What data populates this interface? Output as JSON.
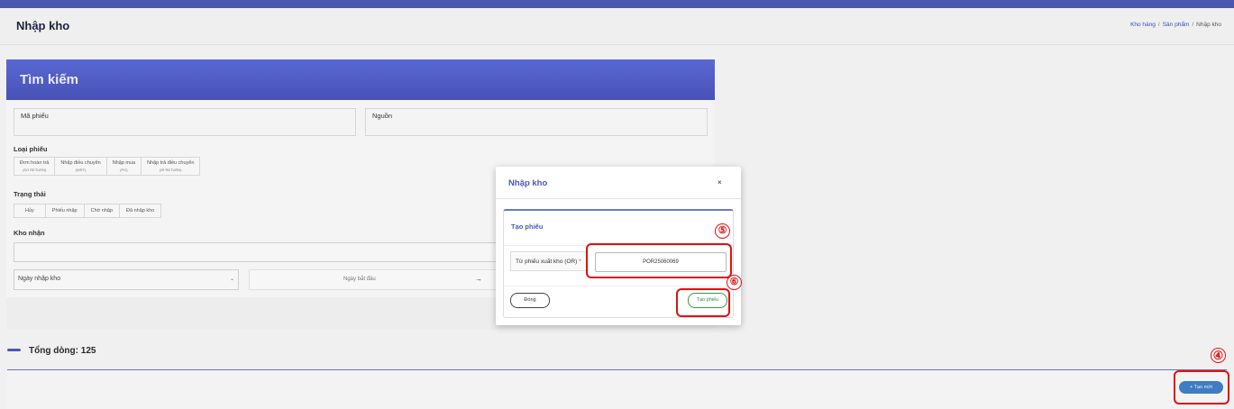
{
  "header": {
    "title": "Nhập kho",
    "breadcrumb": [
      "Kho hàng",
      "Sản phẩm",
      "Nhập kho"
    ]
  },
  "search": {
    "title": "Tìm kiếm",
    "code_label": "Mã phiếu",
    "source_label": "Nguồn",
    "type_label": "Loại phiếu",
    "types": [
      {
        "label": "Đơn hoàn trả",
        "sub": "(SO RETURN)"
      },
      {
        "label": "Nhập điều chuyển",
        "sub": "(WRT)"
      },
      {
        "label": "Nhập mua",
        "sub": "(PO)"
      },
      {
        "label": "Nhập trả điều chuyển",
        "sub": "(IR RETURN)"
      }
    ],
    "status_label": "Trạng thái",
    "statuses": [
      "Hủy",
      "Phiếu nhập",
      "Chờ nhập",
      "Đã nhập kho"
    ],
    "warehouse_label": "Kho nhận",
    "date_select": "Ngày nhập kho",
    "date_start_placeholder": "Ngày bắt đầu",
    "date_arrow": "→"
  },
  "list": {
    "total": "Tổng dòng: 125",
    "new_button": "+ Tạo mới"
  },
  "modal": {
    "title": "Nhập kho",
    "close_icon": "×",
    "section_title": "Tạo phiếu",
    "from_label": "Từ phiếu xuất kho (OR)",
    "required_mark": "*",
    "code_value": "POR25060069",
    "close_button": "Đóng",
    "create_button": "Tạo phiếu"
  },
  "markers": [
    "④",
    "⑤",
    "⑥"
  ],
  "colors": {
    "primary": "#4a56b0",
    "header_gradient": "#5968d2",
    "marker": "#e01010",
    "create": "#2e8a3e",
    "new_button": "#3f7cc1"
  }
}
